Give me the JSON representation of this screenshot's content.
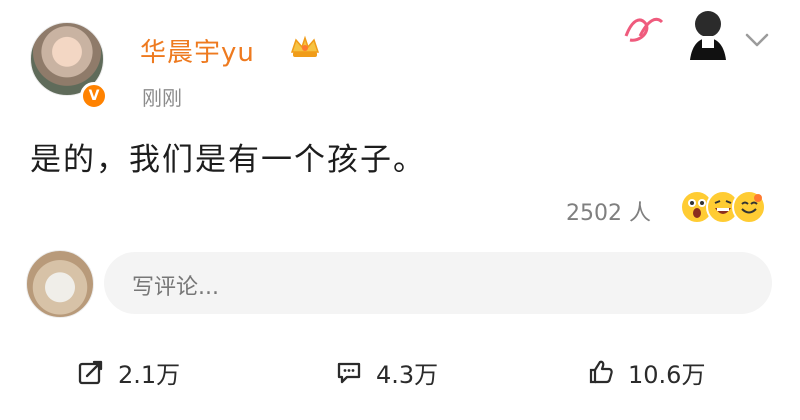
{
  "post": {
    "author": "华晨宇yu",
    "time": "刚刚",
    "text": "是的，我们是有一个孩子。",
    "likes": "2502 人",
    "reactions": [
      "surprised",
      "laugh",
      "smile"
    ]
  },
  "comment": {
    "placeholder": "写评论..."
  },
  "actions": {
    "repost": "2.1万",
    "comment": "4.3万",
    "like": "10.6万"
  },
  "icons": {
    "crown": "crown-icon",
    "verified": "v-icon",
    "chevron": "chevron-down-icon",
    "repost": "share-icon",
    "comment": "comment-icon",
    "like": "thumbs-up-icon"
  },
  "colors": {
    "name": "#ee7a1f",
    "verified": "#ff8200",
    "placeholder_bg": "#f4f4f4",
    "text": "#1d1d1d",
    "muted": "#8c8c8c"
  }
}
